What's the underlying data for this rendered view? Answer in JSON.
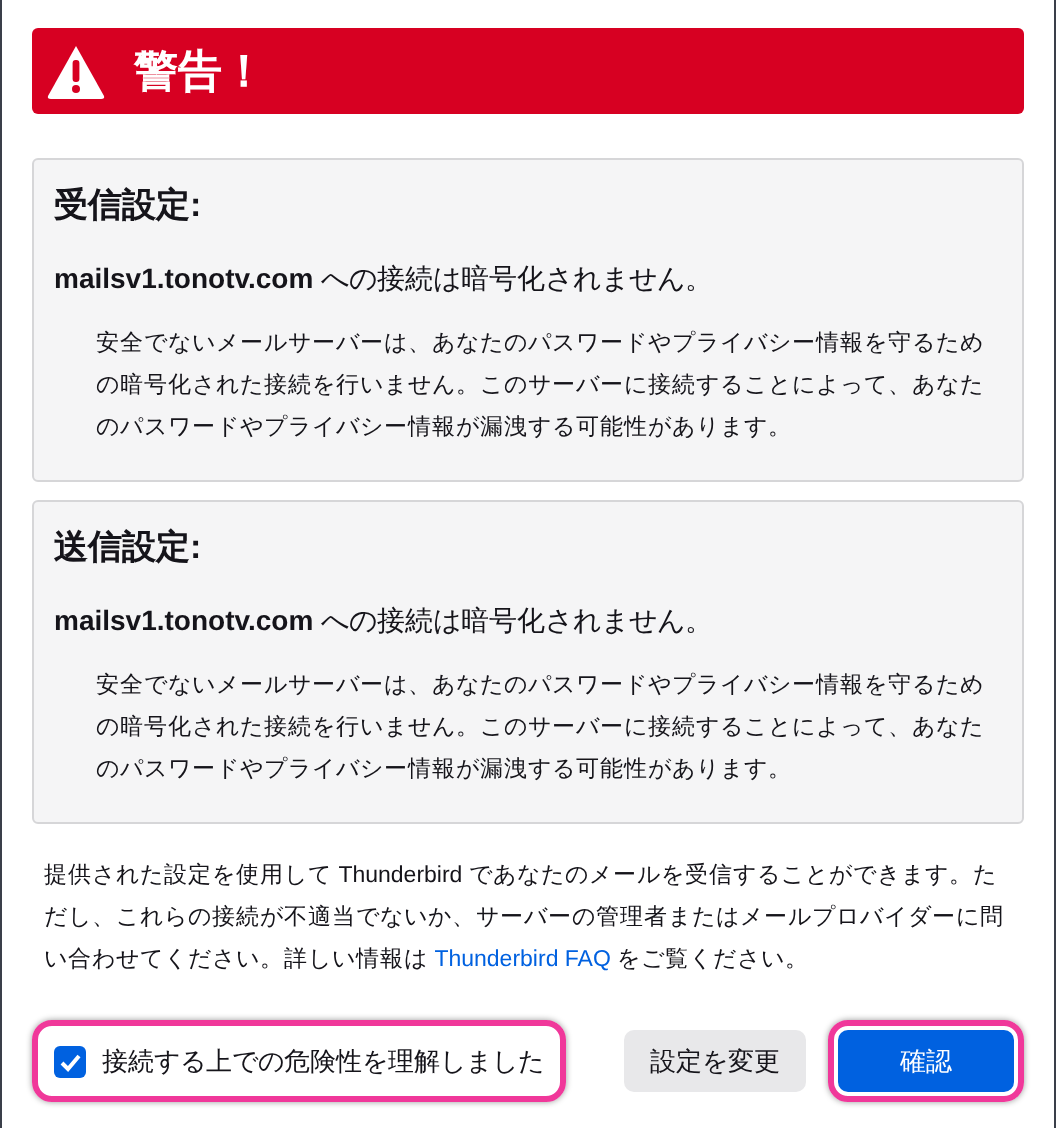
{
  "banner": {
    "title": "警告！"
  },
  "sections": [
    {
      "heading": "受信設定:",
      "host": "mailsv1.tonotv.com",
      "message": " への接続は暗号化されません。",
      "detail": "安全でないメールサーバーは、あなたのパスワードやプライバシー情報を守るための暗号化された接続を行いません。このサーバーに接続することによって、あなたのパスワードやプライバシー情報が漏洩する可能性があります。"
    },
    {
      "heading": "送信設定:",
      "host": "mailsv1.tonotv.com",
      "message": " への接続は暗号化されません。",
      "detail": "安全でないメールサーバーは、あなたのパスワードやプライバシー情報を守るための暗号化された接続を行いません。このサーバーに接続することによって、あなたのパスワードやプライバシー情報が漏洩する可能性があります。"
    }
  ],
  "info": {
    "text_before": "提供された設定を使用して Thunderbird であなたのメールを受信することができます。ただし、これらの接続が不適当でないか、サーバーの管理者またはメールプロバイダーに問い合わせてください。詳しい情報は ",
    "link": "Thunderbird FAQ",
    "text_after": " をご覧ください。"
  },
  "acknowledge": {
    "label": "接続する上での危険性を理解しました",
    "checked": true,
    "highlighted": true
  },
  "buttons": [
    {
      "label": "設定を変更",
      "kind": "secondary",
      "highlighted": false
    },
    {
      "label": "確認",
      "kind": "primary",
      "highlighted": true
    }
  ]
}
